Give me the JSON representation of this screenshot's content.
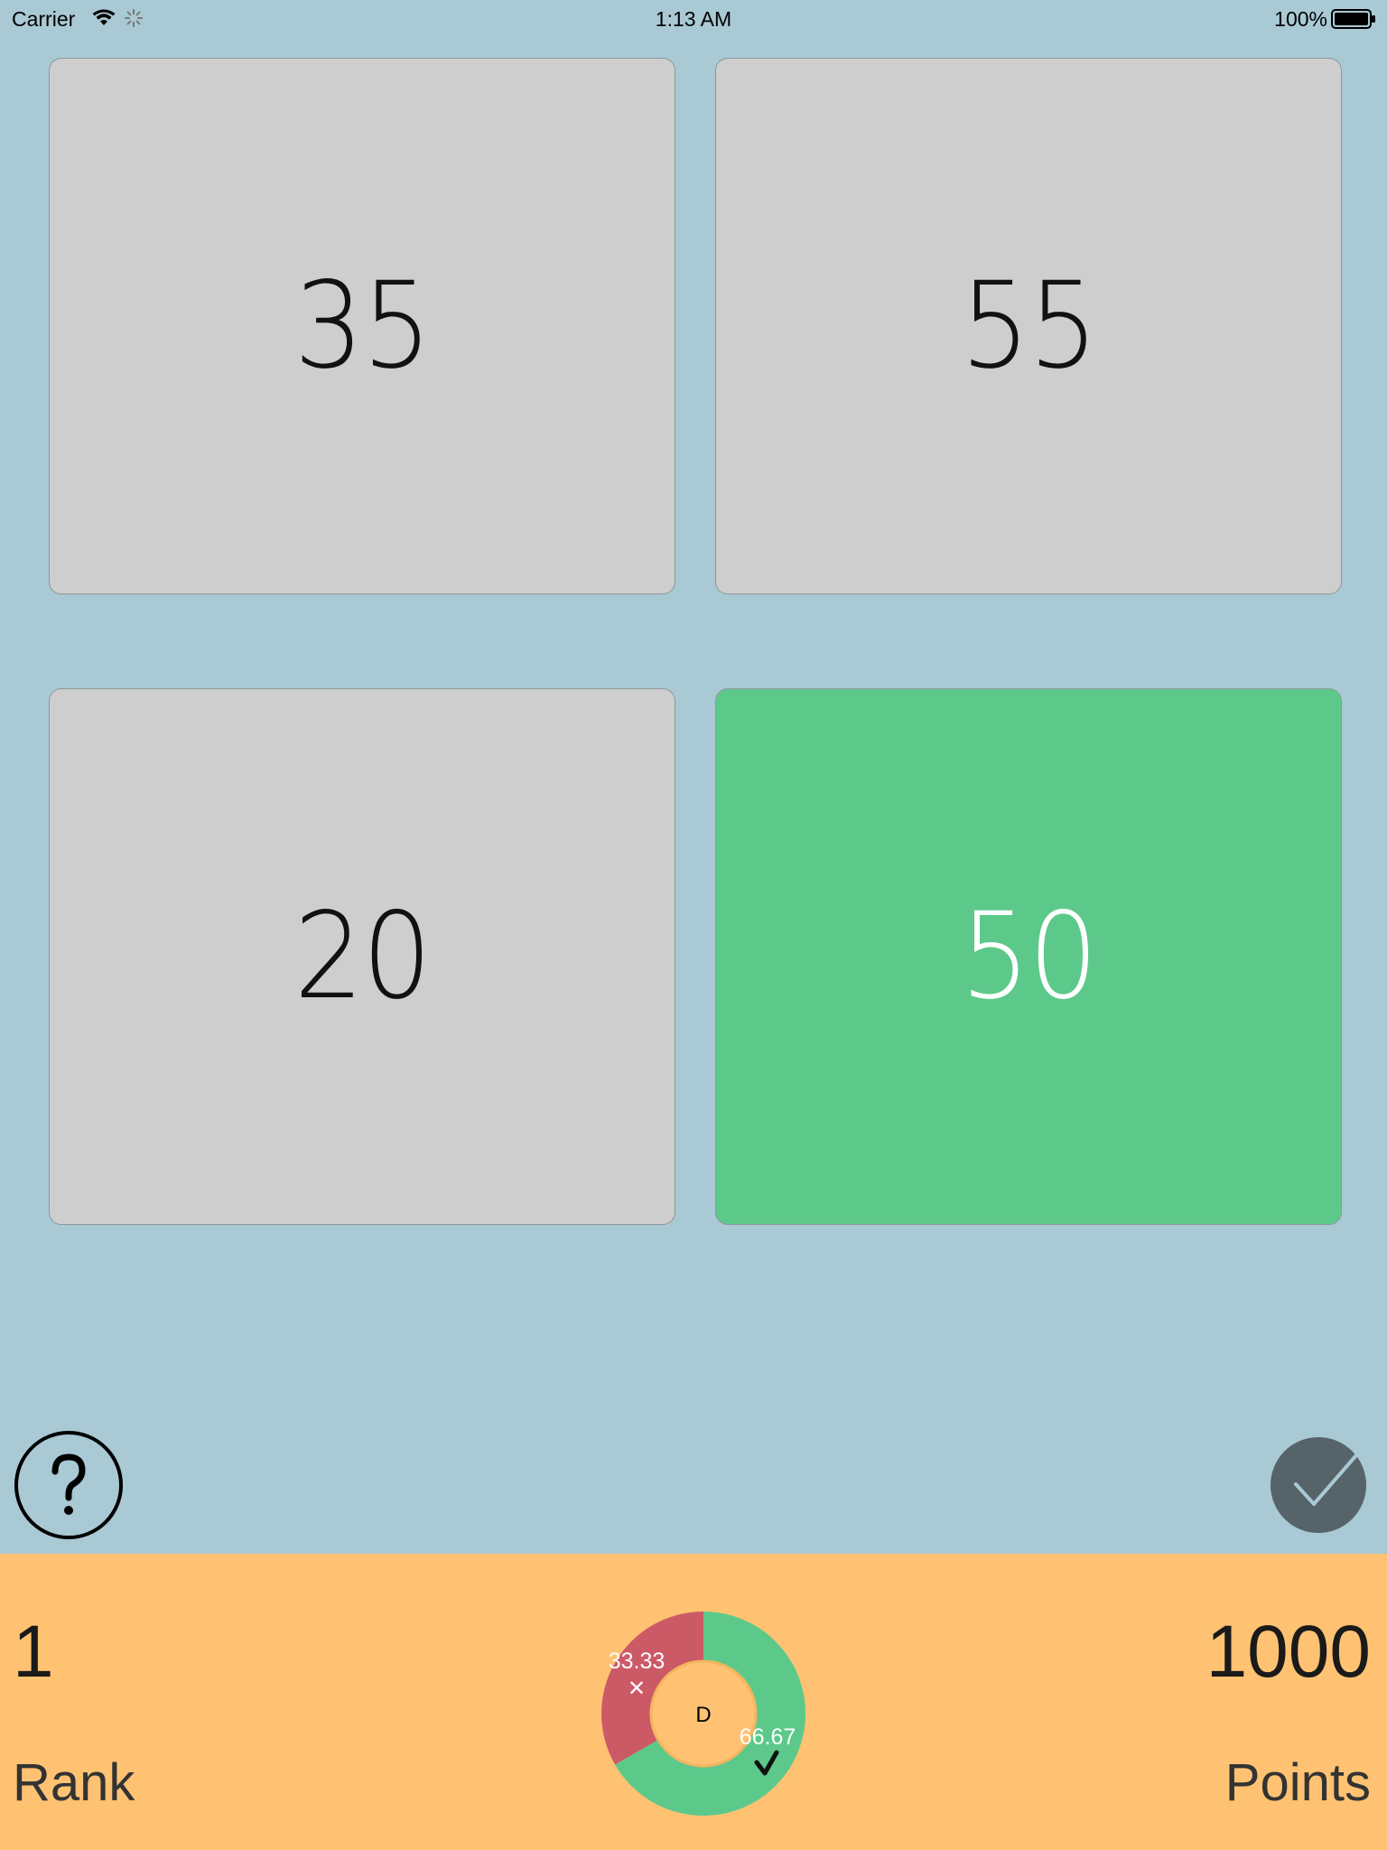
{
  "status_bar": {
    "carrier": "Carrier",
    "time": "1:13 AM",
    "battery": "100%"
  },
  "tiles": [
    {
      "value": "35",
      "selected": false
    },
    {
      "value": "55",
      "selected": false
    },
    {
      "value": "20",
      "selected": false
    },
    {
      "value": "50",
      "selected": true
    }
  ],
  "icons": {
    "help": "question-icon",
    "submit": "checkmark-icon"
  },
  "footer": {
    "rank_value": "1",
    "rank_label": "Rank",
    "points_value": "1000",
    "points_label": "Points"
  },
  "chart_data": {
    "type": "pie",
    "center_label": "D",
    "slices": [
      {
        "label": "33.33",
        "value": 33.33,
        "marker": "✕",
        "color": "#cc5a66"
      },
      {
        "label": "66.67",
        "value": 66.67,
        "marker": "✓",
        "color": "#5cc98a"
      }
    ]
  },
  "colors": {
    "background": "#a9c9d4",
    "tile": "#cecece",
    "tile_selected": "#5cc98a",
    "footer": "#ffc272",
    "submit_button": "#566369"
  }
}
